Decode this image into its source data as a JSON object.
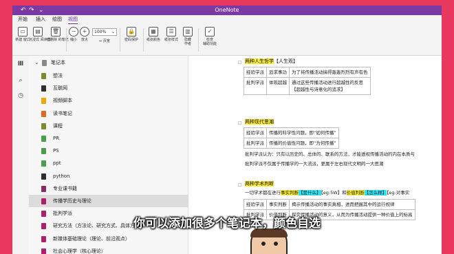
{
  "window": {
    "title": "OneNote"
  },
  "menu": {
    "tabs": [
      "开始",
      "插入",
      "绘图",
      "视图"
    ],
    "active_index": 3
  },
  "ribbon": {
    "buttons": [
      {
        "icon": "new-page-icon",
        "label": "新建\n窗口"
      },
      {
        "icon": "immersive-reader-icon",
        "label": "沉浸式\n阅读器"
      },
      {
        "icon": "deleted-notes-icon",
        "label": "已删除\n的笔记"
      },
      {
        "icon": "zoom-out-icon",
        "label": "缩小"
      },
      {
        "icon": "zoom-in-icon",
        "label": "放大"
      },
      {
        "icon": "password-icon",
        "label": "密码保护"
      },
      {
        "icon": "paper-color-icon",
        "label": "纸张颜色"
      },
      {
        "icon": "paper-style-icon",
        "label": "纸张样式"
      },
      {
        "icon": "hide-authors-icon",
        "label": "隐藏\n作者"
      },
      {
        "icon": "accessibility-check-icon",
        "label": "检查\n辅助功能"
      }
    ],
    "zoom_value": "100%",
    "page_width_label": "页宽"
  },
  "notebook_panel": {
    "title": "笔记本",
    "items": [
      {
        "label": "想法",
        "color": "#7d8a2e"
      },
      {
        "label": "互联网",
        "color": "#2f2f2f"
      },
      {
        "label": "视频脚本",
        "color": "#f2a500"
      },
      {
        "label": "读书笔记",
        "color": "#e06a1f"
      },
      {
        "label": "课程",
        "color": "#7d8a2e"
      },
      {
        "label": "PR",
        "color": "#4aa04a"
      },
      {
        "label": "PS",
        "color": "#4aa04a"
      },
      {
        "label": "ppt",
        "color": "#4aa04a"
      },
      {
        "label": "python",
        "color": "#2f2f2f"
      },
      {
        "label": "专业课书籍",
        "color": "#8a2a6a"
      },
      {
        "label": "传播学历史与理论",
        "color": "#b01f6a"
      },
      {
        "label": "批判学派",
        "color": "#b01f6a"
      },
      {
        "label": "研究方法（方法论、研究方式、具体方法）",
        "color": "#b01f6a"
      },
      {
        "label": "新媒体基础理论（理论、前沿观点）",
        "color": "#b01f6a"
      },
      {
        "label": "社会心理学（核心理论）",
        "color": "#b01f6a"
      }
    ],
    "selected_index": 10
  },
  "content": {
    "sec1": {
      "title": "两种人生哲学",
      "suffix": "【人生观】",
      "rows": [
        [
          "经验学派",
          "追求事功",
          "为了将传播活动搞得轰轰烈烈有声有色"
        ],
        [
          "批判学派",
          "体现超越",
          "通过这些传播活动进行超越性的反思"
        ]
      ],
      "row2_extra": "【超越性与诗意化的追求】"
    },
    "sec2": {
      "title": "两种现代思潮",
      "rows": [
        [
          "经验学派",
          "传播的科学性问题，即“如何传播”"
        ],
        [
          "批判学派",
          "传播的价值性问题，即“为何传播”"
        ]
      ],
      "line1": "批判学派认为：只有以历史的、总体的、联系的方法，才能透视传播活动的内在本质与",
      "line2": "批判学派不仅属于传播学的一大流派，更属于左右现代文明的一大思潮"
    },
    "sec3": {
      "title": "两种学术判断",
      "intro_a": "一切学术都在进行",
      "intro_fact": "事实判断",
      "intro_b": "【是什么】",
      "intro_c": "【eg:5W】和",
      "intro_value": "价值判断",
      "intro_d": "【怎么样】",
      "intro_e": "【eg:对事实",
      "rows": [
        [
          "经验学派",
          "事实判断",
          "揭示传播活动的事实真相，进而把握其中的运行规律"
        ],
        [
          "批判学派",
          "价值判断",
          "探究传播活动的意义，从而为传播活动提供一种价值上的标高"
        ]
      ]
    }
  },
  "overlay": {
    "subtitle": "你可以添加很多个笔记本，颜色自选",
    "watermark": "bili"
  }
}
